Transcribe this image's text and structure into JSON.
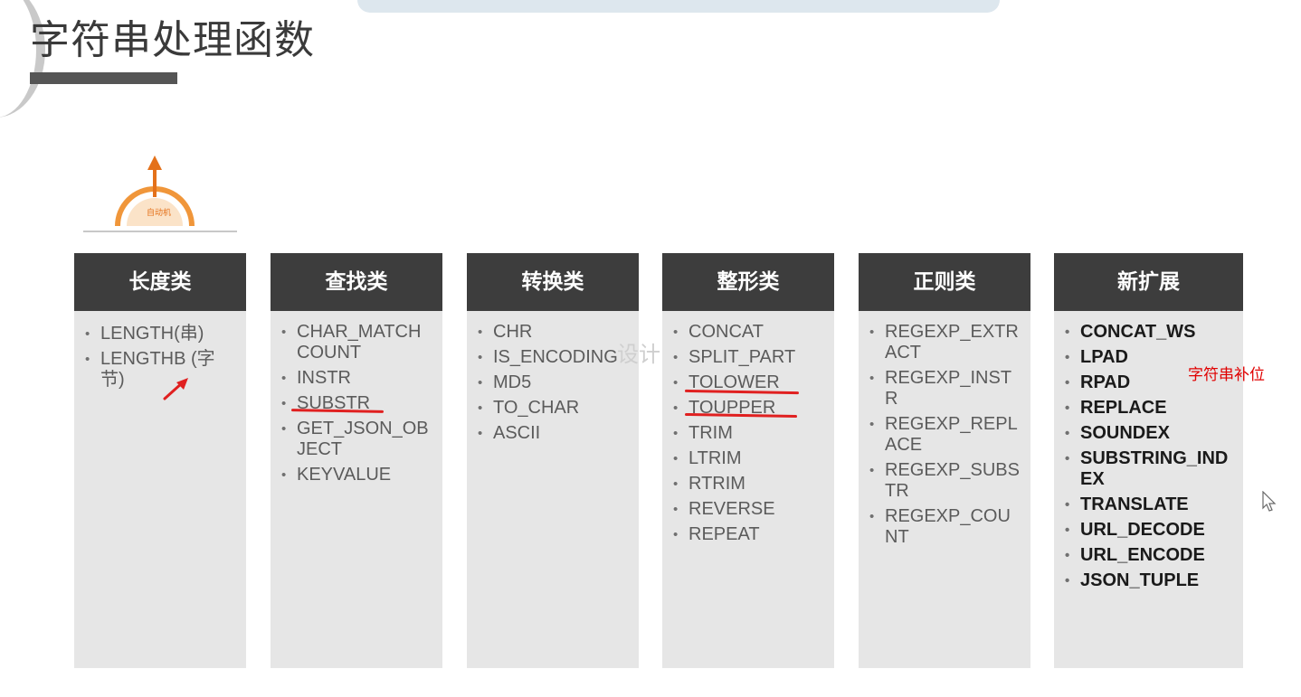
{
  "slide": {
    "title": "字符串处理函数",
    "logo_text": "自动机"
  },
  "columns": [
    {
      "header": "长度类",
      "items": [
        "LENGTH(串)",
        "LENGTHB (字节)"
      ]
    },
    {
      "header": "查找类",
      "items": [
        "CHAR_MATCHCOUNT",
        "INSTR",
        "SUBSTR",
        "GET_JSON_OBJECT",
        "KEYVALUE"
      ]
    },
    {
      "header": "转换类",
      "items": [
        "CHR",
        "IS_ENCODING",
        "MD5",
        "TO_CHAR",
        "ASCII"
      ]
    },
    {
      "header": "整形类",
      "items": [
        "CONCAT",
        "SPLIT_PART",
        "TOLOWER",
        "TOUPPER",
        "TRIM",
        "LTRIM",
        "RTRIM",
        "REVERSE",
        "REPEAT"
      ]
    },
    {
      "header": "正则类",
      "items": [
        "REGEXP_EXTRACT",
        "REGEXP_INSTR",
        "REGEXP_REPLACE",
        "REGEXP_SUBSTR",
        "REGEXP_COUNT"
      ]
    },
    {
      "header": "新扩展",
      "items": [
        "CONCAT_WS",
        "LPAD",
        "RPAD",
        "REPLACE",
        "SOUNDEX",
        "SUBSTRING_INDEX",
        "TRANSLATE",
        "URL_DECODE",
        "URL_ENCODE",
        "JSON_TUPLE"
      ]
    }
  ],
  "annotations": {
    "note": "字符串补位",
    "watermark": "设计"
  },
  "colors": {
    "header_bg": "#3d3d3d",
    "column_bg": "#e6e6e6",
    "annotation_red": "#e02020",
    "logo_orange": "#f0963a"
  },
  "icons": {
    "logo": "rocket-arc-logo-icon",
    "arrow": "red-arrow-icon",
    "cursor": "mouse-cursor-icon"
  }
}
